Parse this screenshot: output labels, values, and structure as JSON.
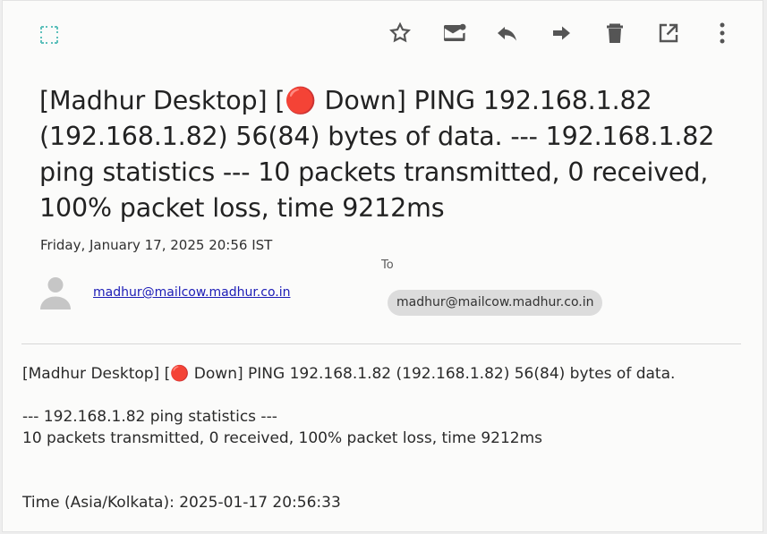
{
  "toolbar": {
    "icons": [
      "expand-icon",
      "star-icon",
      "mark-icon",
      "reply-icon",
      "forward-icon",
      "delete-icon",
      "open-icon",
      "more-icon"
    ],
    "accent_color": "#61b7b7"
  },
  "message": {
    "subject": "[Madhur Desktop] [🔴 Down] PING 192.168.1.82 (192.168.1.82) 56(84) bytes of data. --- 192.168.1.82 ping statistics --- 10 packets transmitted, 0 received, 100% packet loss, time 9212ms",
    "date": "Friday, January 17, 2025 20:56 IST",
    "from": "madhur@mailcow.madhur.co.in",
    "to_label": "To",
    "to": "madhur@mailcow.madhur.co.in",
    "body": {
      "line1": "[Madhur Desktop] [🔴 Down] PING 192.168.1.82 (192.168.1.82) 56(84) bytes of data.",
      "line2": "--- 192.168.1.82 ping statistics ---",
      "line3": "10 packets transmitted, 0 received, 100% packet loss, time 9212ms",
      "line4": "Time (Asia/Kolkata): 2025-01-17 20:56:33"
    }
  }
}
